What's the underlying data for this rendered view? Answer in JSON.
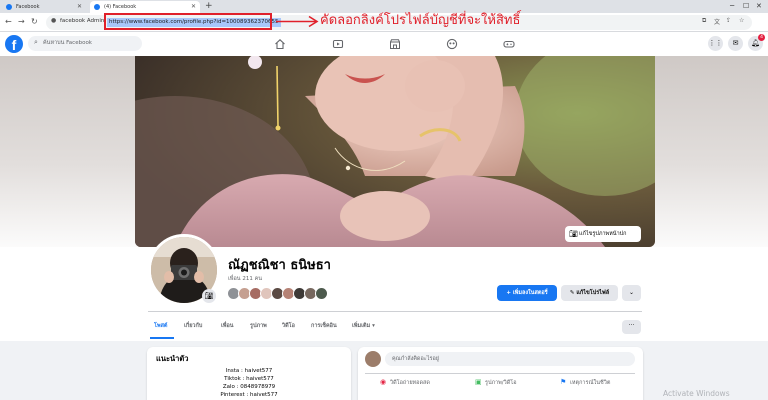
{
  "browser": {
    "tabs": [
      {
        "label": "Facebook",
        "active": false
      },
      {
        "label": "(4) Facebook",
        "active": true
      }
    ],
    "new_tab": "+",
    "address": {
      "site_chip": "facebook Admin",
      "url": "https://www.facebook.com/profile.php?id=100089362370655"
    },
    "annotation": "คัดลอกลิงค์โปรไฟล์บัญชีที่จะให้สิทธิ์",
    "colors": {
      "highlight": "#e0202a"
    }
  },
  "facebook": {
    "logo": "f",
    "search_placeholder": "ค้นหาบน Facebook",
    "notification_count": "4",
    "colors": {
      "brand": "#1877f2"
    }
  },
  "profile": {
    "edit_cover_label": "แก้ไขรูปภาพหน้าปก",
    "name": "ณัฏชณิชา ธนิษธา",
    "friends_count": "เพื่อน 211 คน",
    "add_story_label": "+ เพิ่มลงในสตอรี่",
    "edit_profile_label": "แก้ไขโปรไฟล์",
    "more_label": "⌄",
    "tabs": [
      {
        "label": "โพสต์",
        "active": true
      },
      {
        "label": "เกี่ยวกับ"
      },
      {
        "label": "เพื่อน"
      },
      {
        "label": "รูปภาพ"
      },
      {
        "label": "วิดีโอ"
      },
      {
        "label": "การเช็คอิน"
      },
      {
        "label": "เพิ่มเติม ▾"
      }
    ],
    "tabs_more": "···"
  },
  "intro": {
    "title": "แนะนำตัว",
    "lines": [
      "Insta : haivet577",
      "Tiktok : haivet577",
      "Zalo : 0848978979",
      "Pinterest : haivet577"
    ]
  },
  "composer": {
    "placeholder": "คุณกำลังคิดอะไรอยู่",
    "actions": [
      "วิดีโอถ่ายทอดสด",
      "รูปภาพ/วิดีโอ",
      "เหตุการณ์ในชีวิต"
    ]
  },
  "watermark": "Activate Windows"
}
